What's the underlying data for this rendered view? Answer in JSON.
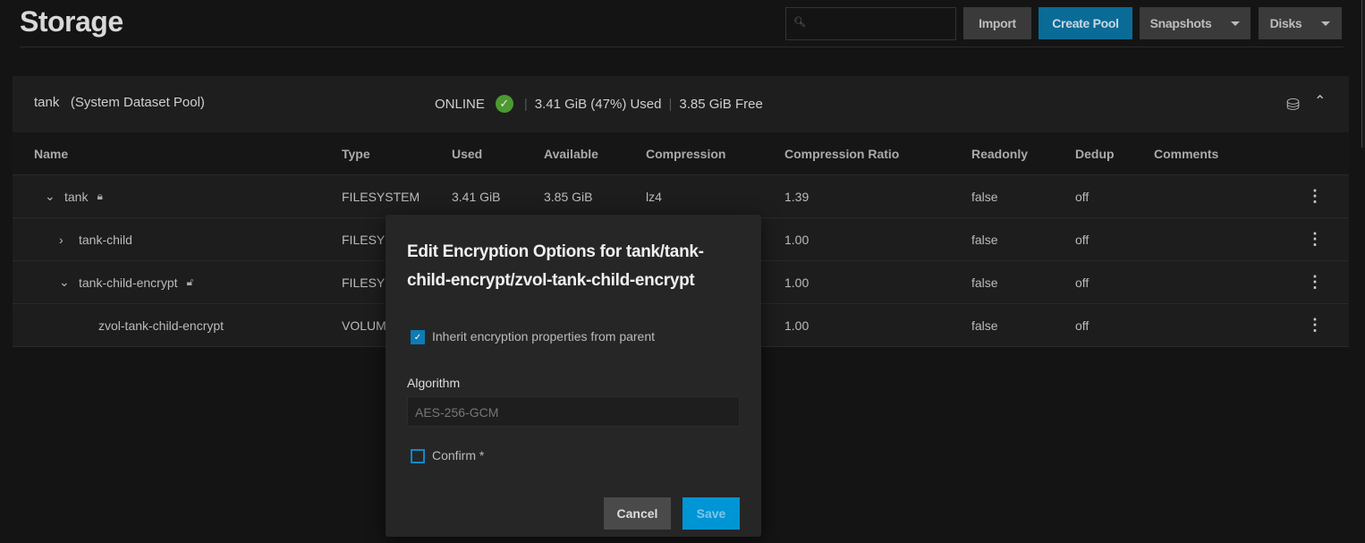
{
  "page": {
    "title": "Storage"
  },
  "toolbar": {
    "search_placeholder": "",
    "import": "Import",
    "create_pool": "Create Pool",
    "snapshots": "Snapshots",
    "disks": "Disks"
  },
  "colors": {
    "accent": "#0a6b97",
    "save": "#0095d5",
    "online": "#4b9a2f"
  },
  "pool": {
    "name": "tank",
    "label": "(System Dataset Pool)",
    "status": "ONLINE",
    "used": "3.41 GiB (47%) Used",
    "free": "3.85 GiB Free"
  },
  "table": {
    "headers": [
      "Name",
      "Type",
      "Used",
      "Available",
      "Compression",
      "Compression Ratio",
      "Readonly",
      "Dedup",
      "Comments"
    ],
    "rows": [
      {
        "name": "tank",
        "type": "FILESYSTEM",
        "used": "3.41 GiB",
        "available": "3.85 GiB",
        "compression": "lz4",
        "ratio": "1.39",
        "readonly": "false",
        "dedup": "off",
        "comments": ""
      },
      {
        "name": "tank-child",
        "type": "FILESYSTEM",
        "used": "",
        "available": "",
        "compression": "",
        "ratio": "1.00",
        "readonly": "false",
        "dedup": "off",
        "comments": ""
      },
      {
        "name": "tank-child-encrypt",
        "type": "FILESYSTEM",
        "used": "",
        "available": "",
        "compression": "",
        "ratio": "1.00",
        "readonly": "false",
        "dedup": "off",
        "comments": ""
      },
      {
        "name": "zvol-tank-child-encrypt",
        "type": "VOLUME",
        "used": "",
        "available": "",
        "compression": "",
        "ratio": "1.00",
        "readonly": "false",
        "dedup": "off",
        "comments": ""
      }
    ]
  },
  "dialog": {
    "title": "Edit Encryption Options for tank/tank-child-encrypt/zvol-tank-child-encrypt",
    "inherit_label": "Inherit encryption properties from parent",
    "inherit_checked": true,
    "algorithm_label": "Algorithm",
    "algorithm_value": "AES-256-GCM",
    "confirm_label": "Confirm *",
    "confirm_checked": false,
    "cancel": "Cancel",
    "save": "Save"
  }
}
